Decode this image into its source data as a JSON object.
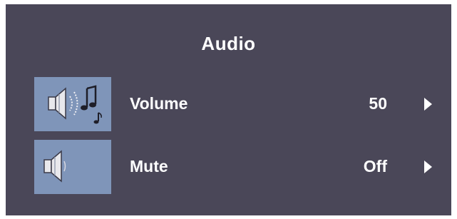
{
  "osd": {
    "title": "Audio",
    "items": [
      {
        "icon": "speaker-with-music-icon",
        "label": "Volume",
        "value": "50"
      },
      {
        "icon": "speaker-icon",
        "label": "Mute",
        "value": "Off"
      }
    ]
  },
  "colors": {
    "panel_background": "#4a4758",
    "icon_background": "#7f95b9",
    "text": "#ffffff"
  }
}
